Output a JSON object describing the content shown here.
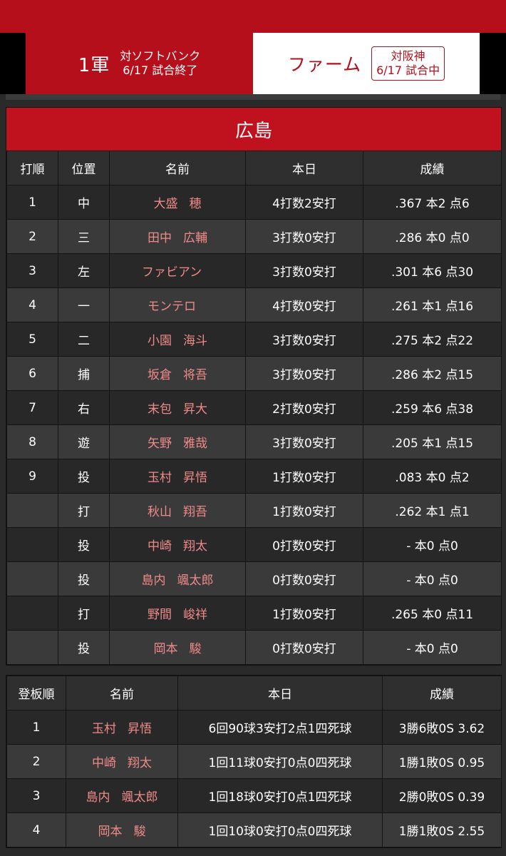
{
  "tabs": {
    "first": {
      "label": "1軍",
      "opponent": "対ソフトバンク",
      "status": "6/17 試合終了"
    },
    "farm": {
      "label": "ファーム",
      "opponent": "対阪神",
      "status": "6/17 試合中"
    }
  },
  "team": {
    "name": "広島"
  },
  "batting": {
    "headers": [
      "打順",
      "位置",
      "名前",
      "本日",
      "成績"
    ],
    "rows": [
      {
        "order": "1",
        "pos": "中",
        "last": "大盛",
        "first": "穂",
        "today": "4打数2安打",
        "stats": ".367 本2 点6"
      },
      {
        "order": "2",
        "pos": "三",
        "last": "田中",
        "first": "広輔",
        "today": "3打数0安打",
        "stats": ".286 本0 点0"
      },
      {
        "order": "3",
        "pos": "左",
        "last": "ファビアン",
        "first": "",
        "today": "3打数0安打",
        "stats": ".301 本6 点30"
      },
      {
        "order": "4",
        "pos": "一",
        "last": "モンテロ",
        "first": "",
        "today": "4打数0安打",
        "stats": ".261 本1 点16"
      },
      {
        "order": "5",
        "pos": "二",
        "last": "小園",
        "first": "海斗",
        "today": "3打数0安打",
        "stats": ".275 本2 点22"
      },
      {
        "order": "6",
        "pos": "捕",
        "last": "坂倉",
        "first": "将吾",
        "today": "3打数0安打",
        "stats": ".286 本2 点15"
      },
      {
        "order": "7",
        "pos": "右",
        "last": "末包",
        "first": "昇大",
        "today": "2打数0安打",
        "stats": ".259 本6 点38"
      },
      {
        "order": "8",
        "pos": "遊",
        "last": "矢野",
        "first": "雅哉",
        "today": "3打数0安打",
        "stats": ".205 本1 点15"
      },
      {
        "order": "9",
        "pos": "投",
        "last": "玉村",
        "first": "昇悟",
        "today": "1打数0安打",
        "stats": ".083 本0 点2"
      },
      {
        "order": "",
        "pos": "打",
        "last": "秋山",
        "first": "翔吾",
        "today": "1打数0安打",
        "stats": ".262 本1 点1"
      },
      {
        "order": "",
        "pos": "投",
        "last": "中崎",
        "first": "翔太",
        "today": "0打数0安打",
        "stats": "- 本0 点0"
      },
      {
        "order": "",
        "pos": "投",
        "last": "島内",
        "first": "颯太郎",
        "today": "0打数0安打",
        "stats": "- 本0 点0"
      },
      {
        "order": "",
        "pos": "打",
        "last": "野間",
        "first": "峻祥",
        "today": "1打数0安打",
        "stats": ".265 本0 点11"
      },
      {
        "order": "",
        "pos": "投",
        "last": "岡本",
        "first": "駿",
        "today": "0打数0安打",
        "stats": "- 本0 点0"
      }
    ]
  },
  "pitching": {
    "headers": [
      "登板順",
      "名前",
      "本日",
      "成績"
    ],
    "rows": [
      {
        "order": "1",
        "last": "玉村",
        "first": "昇悟",
        "today": "6回90球3安打2点1四死球",
        "stats": "3勝6敗0S 3.62"
      },
      {
        "order": "2",
        "last": "中崎",
        "first": "翔太",
        "today": "1回11球0安打0点0四死球",
        "stats": "1勝1敗0S 0.95"
      },
      {
        "order": "3",
        "last": "島内",
        "first": "颯太郎",
        "today": "1回18球0安打0点1四死球",
        "stats": "2勝0敗0S 0.39"
      },
      {
        "order": "4",
        "last": "岡本",
        "first": "駿",
        "today": "1回10球0安打0点0四死球",
        "stats": "1勝1敗0S 2.55"
      }
    ]
  }
}
